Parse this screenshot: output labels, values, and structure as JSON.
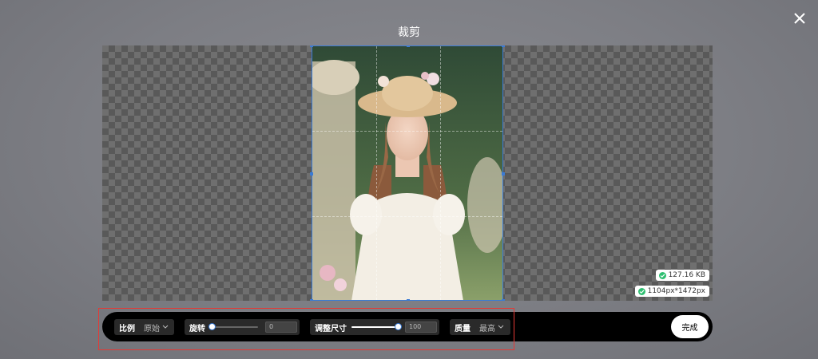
{
  "dialog": {
    "title": "裁剪",
    "close_icon": "close-icon"
  },
  "image_info": {
    "file_size": "127.16 KB",
    "dimensions": "1104px*1472px",
    "status_color": "#2fbf71"
  },
  "toolbar": {
    "ratio": {
      "label": "比例",
      "value": "原始"
    },
    "rotate": {
      "label": "旋转",
      "value": "0",
      "level": 0
    },
    "resize": {
      "label": "调整尺寸",
      "value": "100",
      "level": 1
    },
    "quality": {
      "label": "质量",
      "value": "最高"
    },
    "done_label": "完成"
  },
  "colors": {
    "accent": "#3a7bd5",
    "highlight": "#e53935"
  }
}
